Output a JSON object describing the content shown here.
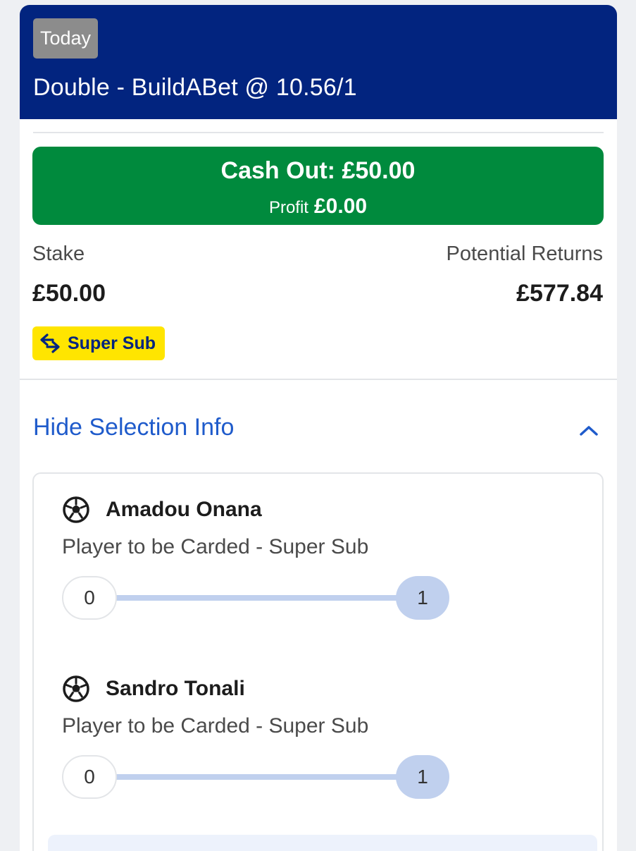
{
  "header": {
    "badge": "Today",
    "title": "Double - BuildABet @ 10.56/1"
  },
  "cashout": {
    "label": "Cash Out: £50.00",
    "profit_label": "Profit",
    "profit_value": "£0.00"
  },
  "summary": {
    "stake_label": "Stake",
    "stake_value": "£50.00",
    "returns_label": "Potential Returns",
    "returns_value": "£577.84"
  },
  "badge": {
    "label": "Super Sub",
    "icon": "swap-arrows-icon"
  },
  "toggle": {
    "label": "Hide Selection Info",
    "icon": "chevron-up-icon"
  },
  "selections": [
    {
      "player": "Amadou Onana",
      "market": "Player to be Carded - Super Sub",
      "progress_start": "0",
      "progress_end": "1",
      "icon": "football-icon"
    },
    {
      "player": "Sandro Tonali",
      "market": "Player to be Carded - Super Sub",
      "progress_start": "0",
      "progress_end": "1",
      "icon": "football-icon"
    }
  ],
  "colors": {
    "header_bg": "#02247f",
    "cashout_bg": "#008a3d",
    "badge_bg": "#ffe500",
    "link": "#1f5bcb",
    "progress": "#c0d0ee"
  }
}
